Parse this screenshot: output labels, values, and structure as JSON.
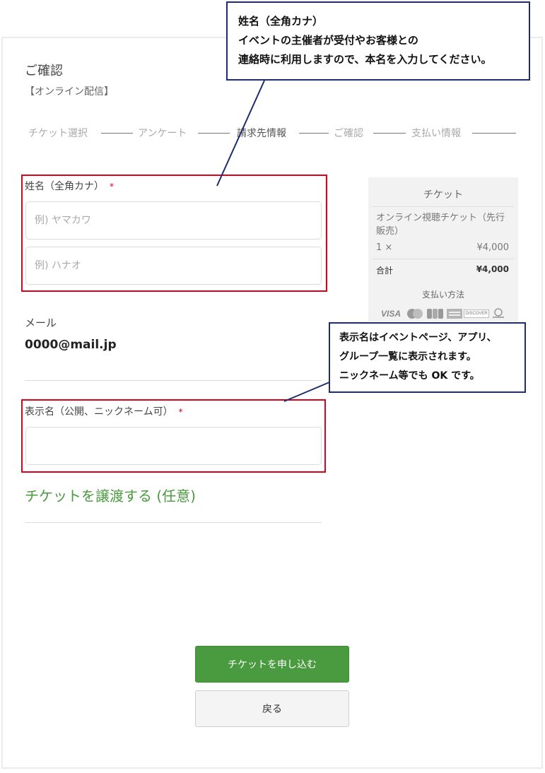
{
  "page": {
    "title": "ご確認",
    "subtitle": "【オンライン配信】"
  },
  "steps": [
    "チケット選択",
    "アンケート",
    "請求先情報",
    "ご確認",
    "支払い情報"
  ],
  "form": {
    "name": {
      "label": "姓名（全角カナ）",
      "required_mark": "*",
      "placeholder_last": "例) ヤマカワ",
      "placeholder_first": "例) ハナオ"
    },
    "email": {
      "label": "メール",
      "value": "0000@mail.jp"
    },
    "display_name": {
      "label": "表示名（公開、ニックネーム可）",
      "required_mark": "*",
      "value": ""
    },
    "transfer_link": "チケットを譲渡する (任意)"
  },
  "summary": {
    "title": "チケット",
    "item_name": "オンライン視聴チケット（先行販売）",
    "quantity": "1 ×",
    "price": "¥4,000",
    "total_label": "合計",
    "total_value": "¥4,000",
    "payment_label": "支払い方法",
    "payment_icons": [
      "visa-icon",
      "mastercard-icon",
      "jcb-icon",
      "amex-icon",
      "discover-icon",
      "diners-club-icon"
    ],
    "card_text": {
      "visa": "VISA",
      "jcb": "JCB",
      "discover": "DISCOVER"
    }
  },
  "buttons": {
    "submit": "チケットを申し込む",
    "back": "戻る"
  },
  "callouts": {
    "name_note": {
      "title": "姓名（全角カナ）",
      "line1": "イベントの主催者が受付やお客様との",
      "line2": "連絡時に利用しますので、本名を入力してください。"
    },
    "display_note": {
      "line1": "表示名はイベントページ、アプリ、",
      "line2": "グループ一覧に表示されます。",
      "line3": "ニックネーム等でも OK です。"
    }
  },
  "colors": {
    "accent_green": "#4a9a3f",
    "highlight_red": "#e0001b",
    "callout_border": "#1f2d6e",
    "required_red": "#d0021b"
  }
}
